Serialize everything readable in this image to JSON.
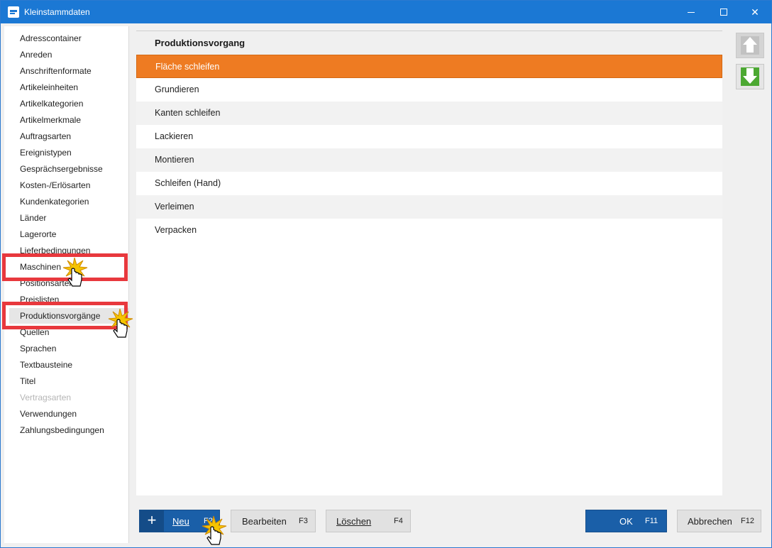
{
  "window": {
    "title": "Kleinstammdaten"
  },
  "sidebar": {
    "items": [
      {
        "label": "Adresscontainer"
      },
      {
        "label": "Anreden"
      },
      {
        "label": "Anschriftenformate"
      },
      {
        "label": "Artikeleinheiten"
      },
      {
        "label": "Artikelkategorien"
      },
      {
        "label": "Artikelmerkmale"
      },
      {
        "label": "Auftragsarten"
      },
      {
        "label": "Ereignistypen"
      },
      {
        "label": "Gesprächsergebnisse"
      },
      {
        "label": "Kosten-/Erlösarten"
      },
      {
        "label": "Kundenkategorien"
      },
      {
        "label": "Länder"
      },
      {
        "label": "Lagerorte"
      },
      {
        "label": "Lieferbedingungen"
      },
      {
        "label": "Maschinen"
      },
      {
        "label": "Positionsarten"
      },
      {
        "label": "Preislisten"
      },
      {
        "label": "Produktionsvorgänge"
      },
      {
        "label": "Quellen"
      },
      {
        "label": "Sprachen"
      },
      {
        "label": "Textbausteine"
      },
      {
        "label": "Titel"
      },
      {
        "label": "Vertragsarten"
      },
      {
        "label": "Verwendungen"
      },
      {
        "label": "Zahlungsbedingungen"
      }
    ]
  },
  "list": {
    "header": "Produktionsvorgang",
    "rows": [
      {
        "label": "Fläche schleifen"
      },
      {
        "label": "Grundieren"
      },
      {
        "label": "Kanten schleifen"
      },
      {
        "label": "Lackieren"
      },
      {
        "label": "Montieren"
      },
      {
        "label": "Schleifen (Hand)"
      },
      {
        "label": "Verleimen"
      },
      {
        "label": "Verpacken"
      }
    ]
  },
  "buttons": {
    "neu": {
      "plus": "+",
      "label": "Neu",
      "key": "F2"
    },
    "bearbeiten": {
      "label": "Bearbeiten",
      "key": "F3"
    },
    "loeschen": {
      "label": "Löschen",
      "key": "F4"
    },
    "ok": {
      "label": "OK",
      "key": "F11"
    },
    "abbrechen": {
      "label": "Abbrechen",
      "key": "F12"
    }
  },
  "icons": {
    "move_up": "arrow-up-icon",
    "move_down": "arrow-down-icon",
    "cursor": "hand-pointer-icon"
  },
  "colors": {
    "titlebar": "#1b78d4",
    "selection": "#ee7b22",
    "primary_button": "#1a5fa8",
    "highlight": "#e8383d",
    "move_down": "#4ca832"
  }
}
